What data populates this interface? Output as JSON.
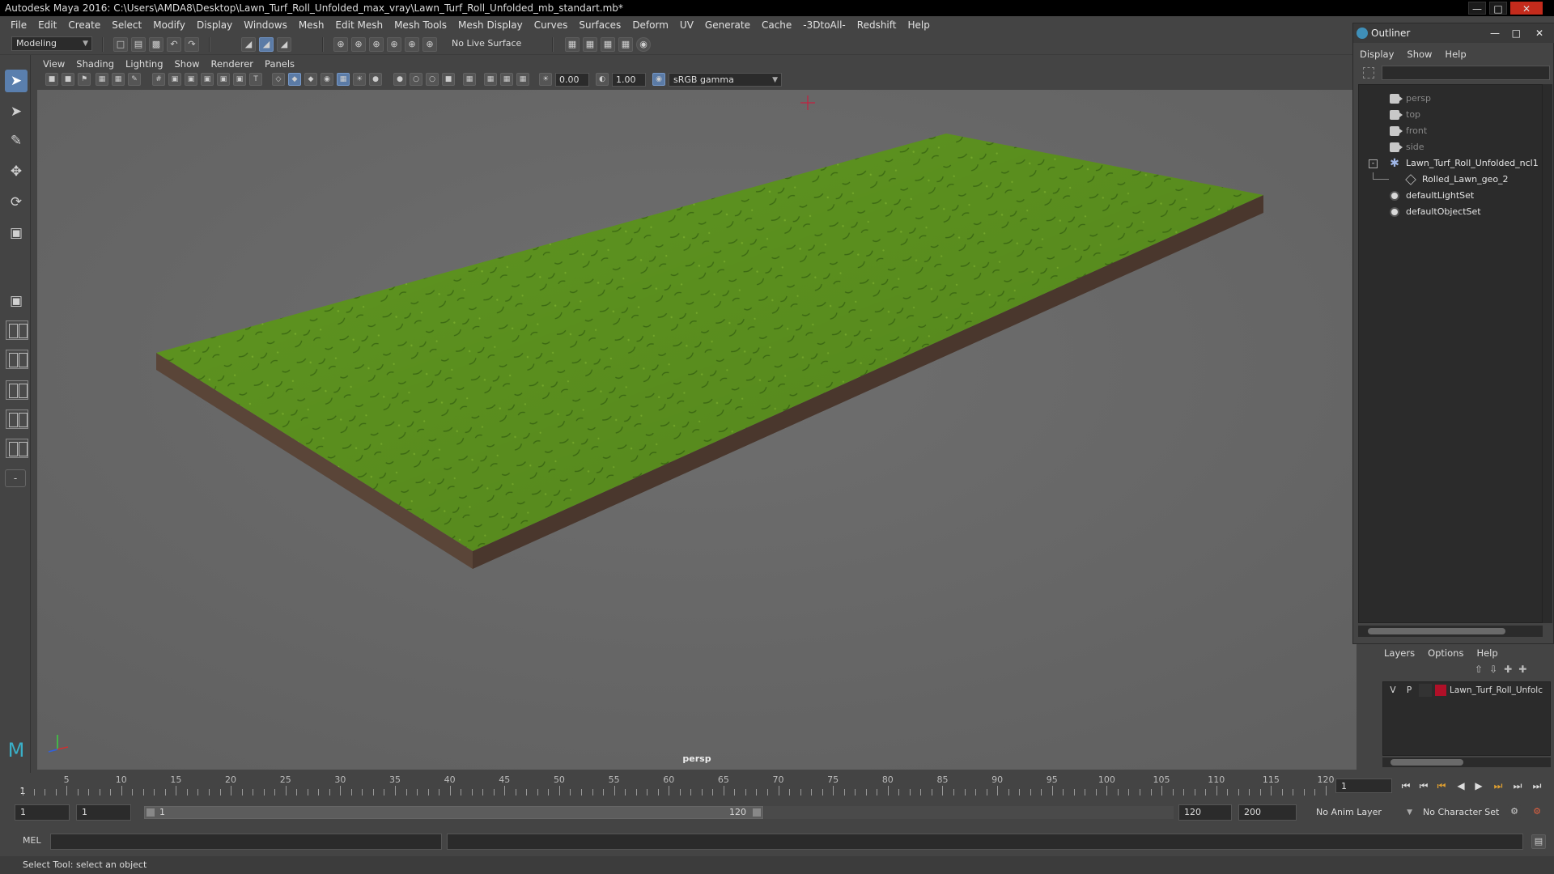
{
  "window": {
    "title": "Autodesk Maya 2016: C:\\Users\\AMDA8\\Desktop\\Lawn_Turf_Roll_Unfolded_max_vray\\Lawn_Turf_Roll_Unfolded_mb_standart.mb*"
  },
  "main_menu": [
    "File",
    "Edit",
    "Create",
    "Select",
    "Modify",
    "Display",
    "Windows",
    "Mesh",
    "Edit Mesh",
    "Mesh Tools",
    "Mesh Display",
    "Curves",
    "Surfaces",
    "Deform",
    "UV",
    "Generate",
    "Cache",
    "-3DtoAll-",
    "Redshift",
    "Help"
  ],
  "toolbar": {
    "workspace": "Modeling",
    "live_surface": "No Live Surface"
  },
  "viewport": {
    "menu": [
      "View",
      "Shading",
      "Lighting",
      "Show",
      "Renderer",
      "Panels"
    ],
    "exposure": "0.00",
    "gamma": "1.00",
    "color_space": "sRGB gamma",
    "camera_label": "persp",
    "colors": {
      "grass": "#5f9620",
      "soil": "#5a4538",
      "bg": "#6c6c6c"
    }
  },
  "outliner": {
    "title": "Outliner",
    "menu": [
      "Display",
      "Show",
      "Help"
    ],
    "items": [
      {
        "label": "persp",
        "icon": "camera-icon"
      },
      {
        "label": "top",
        "icon": "camera-icon"
      },
      {
        "label": "front",
        "icon": "camera-icon"
      },
      {
        "label": "side",
        "icon": "camera-icon"
      },
      {
        "label": "Lawn_Turf_Roll_Unfolded_ncl1",
        "icon": "group-icon"
      },
      {
        "label": "Rolled_Lawn_geo_2",
        "icon": "mesh-icon"
      },
      {
        "label": "defaultLightSet",
        "icon": "set-icon"
      },
      {
        "label": "defaultObjectSet",
        "icon": "set-icon"
      }
    ]
  },
  "layers": {
    "menu": [
      "Layers",
      "Options",
      "Help"
    ],
    "row": {
      "v": "V",
      "p": "P",
      "name": "Lawn_Turf_Roll_Unfolc",
      "color": "#b01028"
    }
  },
  "timeline": {
    "ticks": [
      "5",
      "10",
      "15",
      "20",
      "25",
      "30",
      "35",
      "40",
      "45",
      "50",
      "55",
      "60",
      "65",
      "70",
      "75",
      "80",
      "85",
      "90",
      "95",
      "100",
      "105",
      "110",
      "115",
      "120"
    ],
    "start_marker": "1",
    "current_frame": "1"
  },
  "range": {
    "start": "1",
    "playback_start": "1",
    "slider_start": "1",
    "slider_end": "120",
    "playback_end": "120",
    "end": "200",
    "anim_layer": "No Anim Layer",
    "character_set": "No Character Set"
  },
  "command": {
    "mode": "MEL"
  },
  "status": {
    "help_text": "Select Tool: select an object"
  }
}
